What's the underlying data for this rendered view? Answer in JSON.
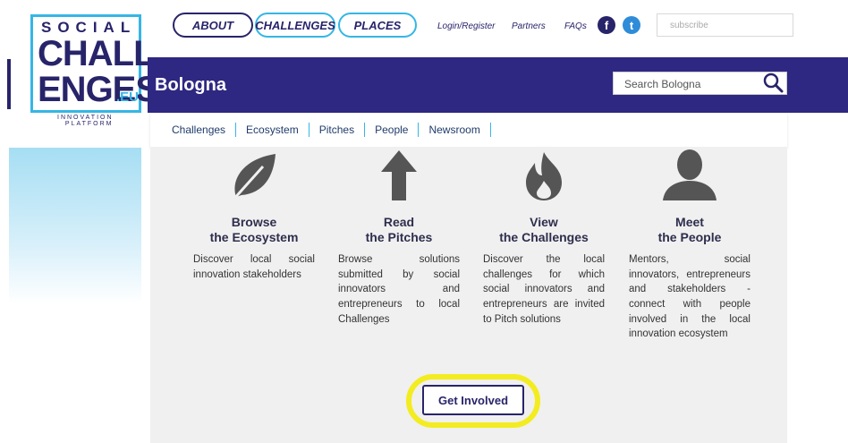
{
  "logo": {
    "line1": "SOCIAL",
    "line2": "CHALL",
    "line3": "ENGES",
    "suffix": ".EU",
    "tag1": "INNOVATION",
    "tag2": "PLATFORM"
  },
  "topnav": {
    "about": "ABOUT",
    "challenges": "CHALLENGES",
    "places": "PLACES",
    "login": "Login/Register",
    "partners": "Partners",
    "faqs": "FAQs",
    "facebook_glyph": "f",
    "twitter_glyph": "t",
    "subscribe_placeholder": "subscribe"
  },
  "header": {
    "city": "Bologna",
    "search_placeholder": "Search Bologna"
  },
  "subnav": [
    "Challenges",
    "Ecosystem",
    "Pitches",
    "People",
    "Newsroom"
  ],
  "columns": [
    {
      "icon": "leaf-icon",
      "title1": "Browse",
      "title2": "the Ecosystem",
      "desc": "Discover local social innovation stakeholders"
    },
    {
      "icon": "arrow-up-icon",
      "title1": "Read",
      "title2": "the Pitches",
      "desc": "Browse solutions submitted by social innovators and entrepreneurs to local Challenges"
    },
    {
      "icon": "flame-icon",
      "title1": "View",
      "title2": "the Challenges",
      "desc": "Discover the local challenges for which social innovators and entrepreneurs are invited to Pitch solutions"
    },
    {
      "icon": "person-icon",
      "title1": "Meet",
      "title2": "the People",
      "desc": "Mentors, social innovators, entrepreneurs and stakeholders - connect with people involved in the local innovation ecosystem"
    }
  ],
  "cta": {
    "label": "Get Involved"
  },
  "colors": {
    "brand_purple": "#2e2882",
    "accent_blue": "#35b6e5",
    "highlight_yellow": "#f3ec20"
  }
}
